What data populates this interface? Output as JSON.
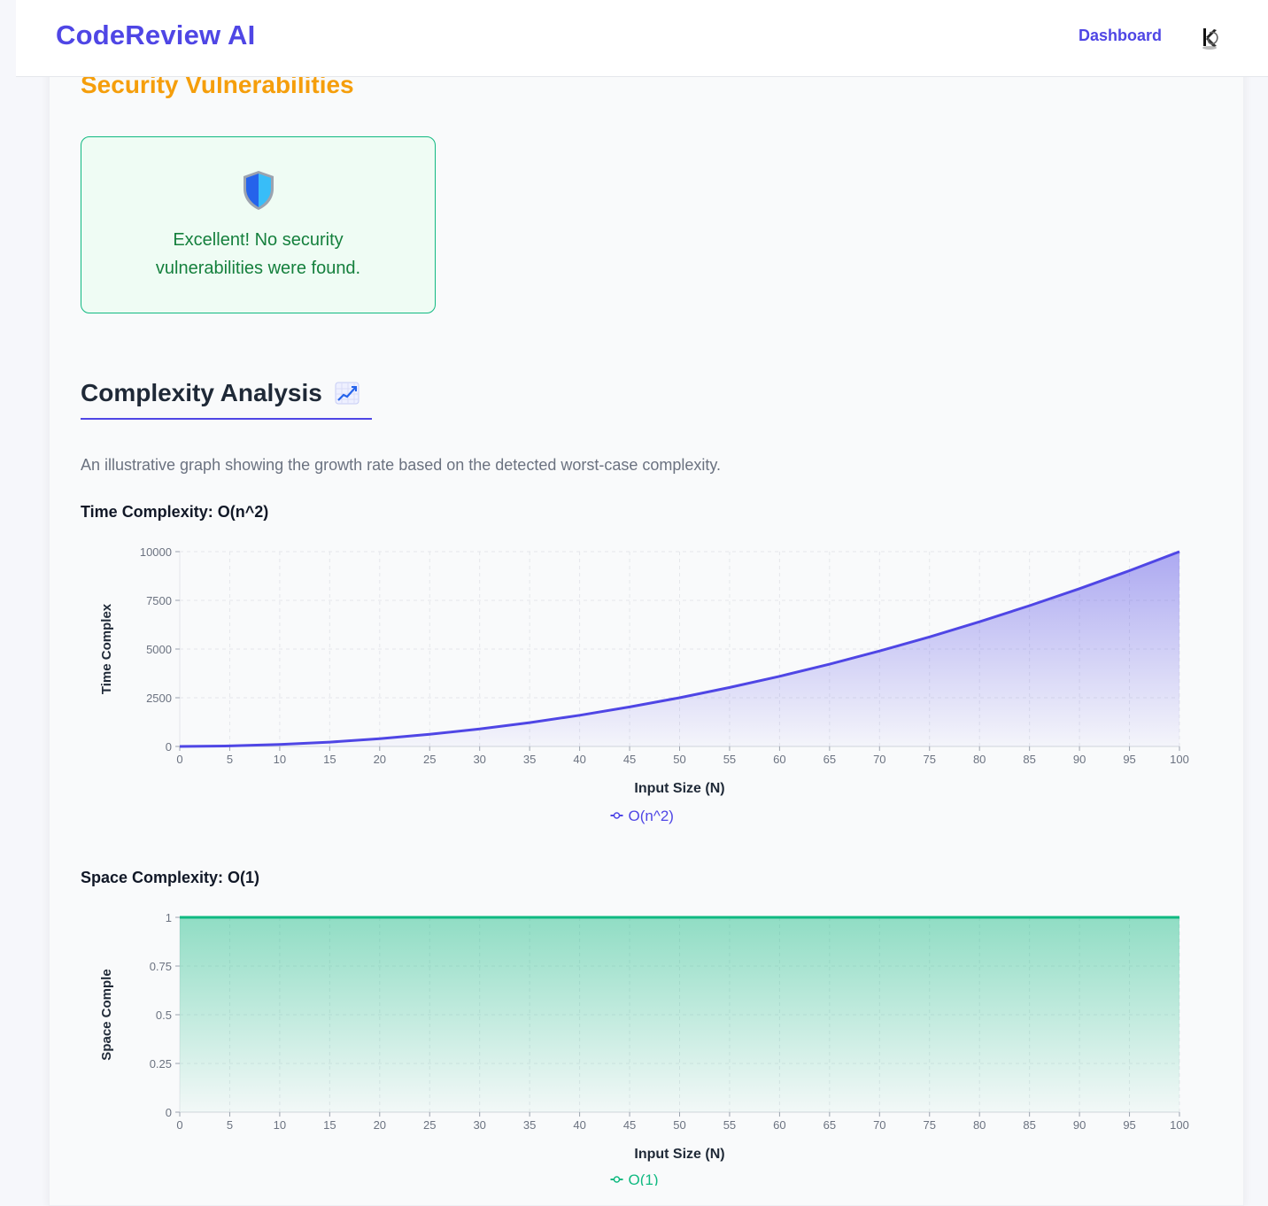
{
  "header": {
    "brand": "CodeReview AI",
    "nav": {
      "dashboard": "Dashboard"
    },
    "avatar_icon": "user-avatar-icon"
  },
  "security": {
    "title": "Security Vulnerabilities",
    "message_line1": "Excellent! No security",
    "message_line2": "vulnerabilities were found.",
    "icon": "shield-icon"
  },
  "complexity": {
    "title": "Complexity Analysis",
    "title_icon": "chart-increasing-icon",
    "description": "An illustrative graph showing the growth rate based on the detected worst-case complexity.",
    "time_heading": "Time Complexity: O(n^2)",
    "space_heading": "Space Complexity: O(1)"
  },
  "colors": {
    "brand": "#4f46e5",
    "warning": "#f59e0b",
    "success": "#10b981",
    "time_series": "#4f46e5",
    "space_series": "#10b981"
  },
  "chart_data": [
    {
      "type": "area",
      "name": "time",
      "xlabel": "Input Size (N)",
      "ylabel": "Time Complex",
      "xlim": [
        0,
        100
      ],
      "ylim": [
        0,
        10000
      ],
      "x_ticks": [
        0,
        5,
        10,
        15,
        20,
        25,
        30,
        35,
        40,
        45,
        50,
        55,
        60,
        65,
        70,
        75,
        80,
        85,
        90,
        95,
        100
      ],
      "y_ticks": [
        0,
        2500,
        5000,
        7500,
        10000
      ],
      "grid": true,
      "legend": "bottom-center",
      "series": [
        {
          "name": "O(n^2)",
          "formula": "n^2",
          "x": [
            0,
            5,
            10,
            15,
            20,
            25,
            30,
            35,
            40,
            45,
            50,
            55,
            60,
            65,
            70,
            75,
            80,
            85,
            90,
            95,
            100
          ],
          "values": [
            0,
            25,
            100,
            225,
            400,
            625,
            900,
            1225,
            1600,
            2025,
            2500,
            3025,
            3600,
            4225,
            4900,
            5625,
            6400,
            7225,
            8100,
            9025,
            10000
          ]
        }
      ]
    },
    {
      "type": "area",
      "name": "space",
      "xlabel": "Input Size (N)",
      "ylabel": "Space Comple",
      "xlim": [
        0,
        100
      ],
      "ylim": [
        0,
        1
      ],
      "x_ticks": [
        0,
        5,
        10,
        15,
        20,
        25,
        30,
        35,
        40,
        45,
        50,
        55,
        60,
        65,
        70,
        75,
        80,
        85,
        90,
        95,
        100
      ],
      "y_ticks": [
        0,
        0.25,
        0.5,
        0.75,
        1
      ],
      "grid": true,
      "legend": "bottom-center",
      "series": [
        {
          "name": "O(1)",
          "formula": "1",
          "x": [
            0,
            5,
            10,
            15,
            20,
            25,
            30,
            35,
            40,
            45,
            50,
            55,
            60,
            65,
            70,
            75,
            80,
            85,
            90,
            95,
            100
          ],
          "values": [
            1,
            1,
            1,
            1,
            1,
            1,
            1,
            1,
            1,
            1,
            1,
            1,
            1,
            1,
            1,
            1,
            1,
            1,
            1,
            1,
            1
          ]
        }
      ]
    }
  ]
}
